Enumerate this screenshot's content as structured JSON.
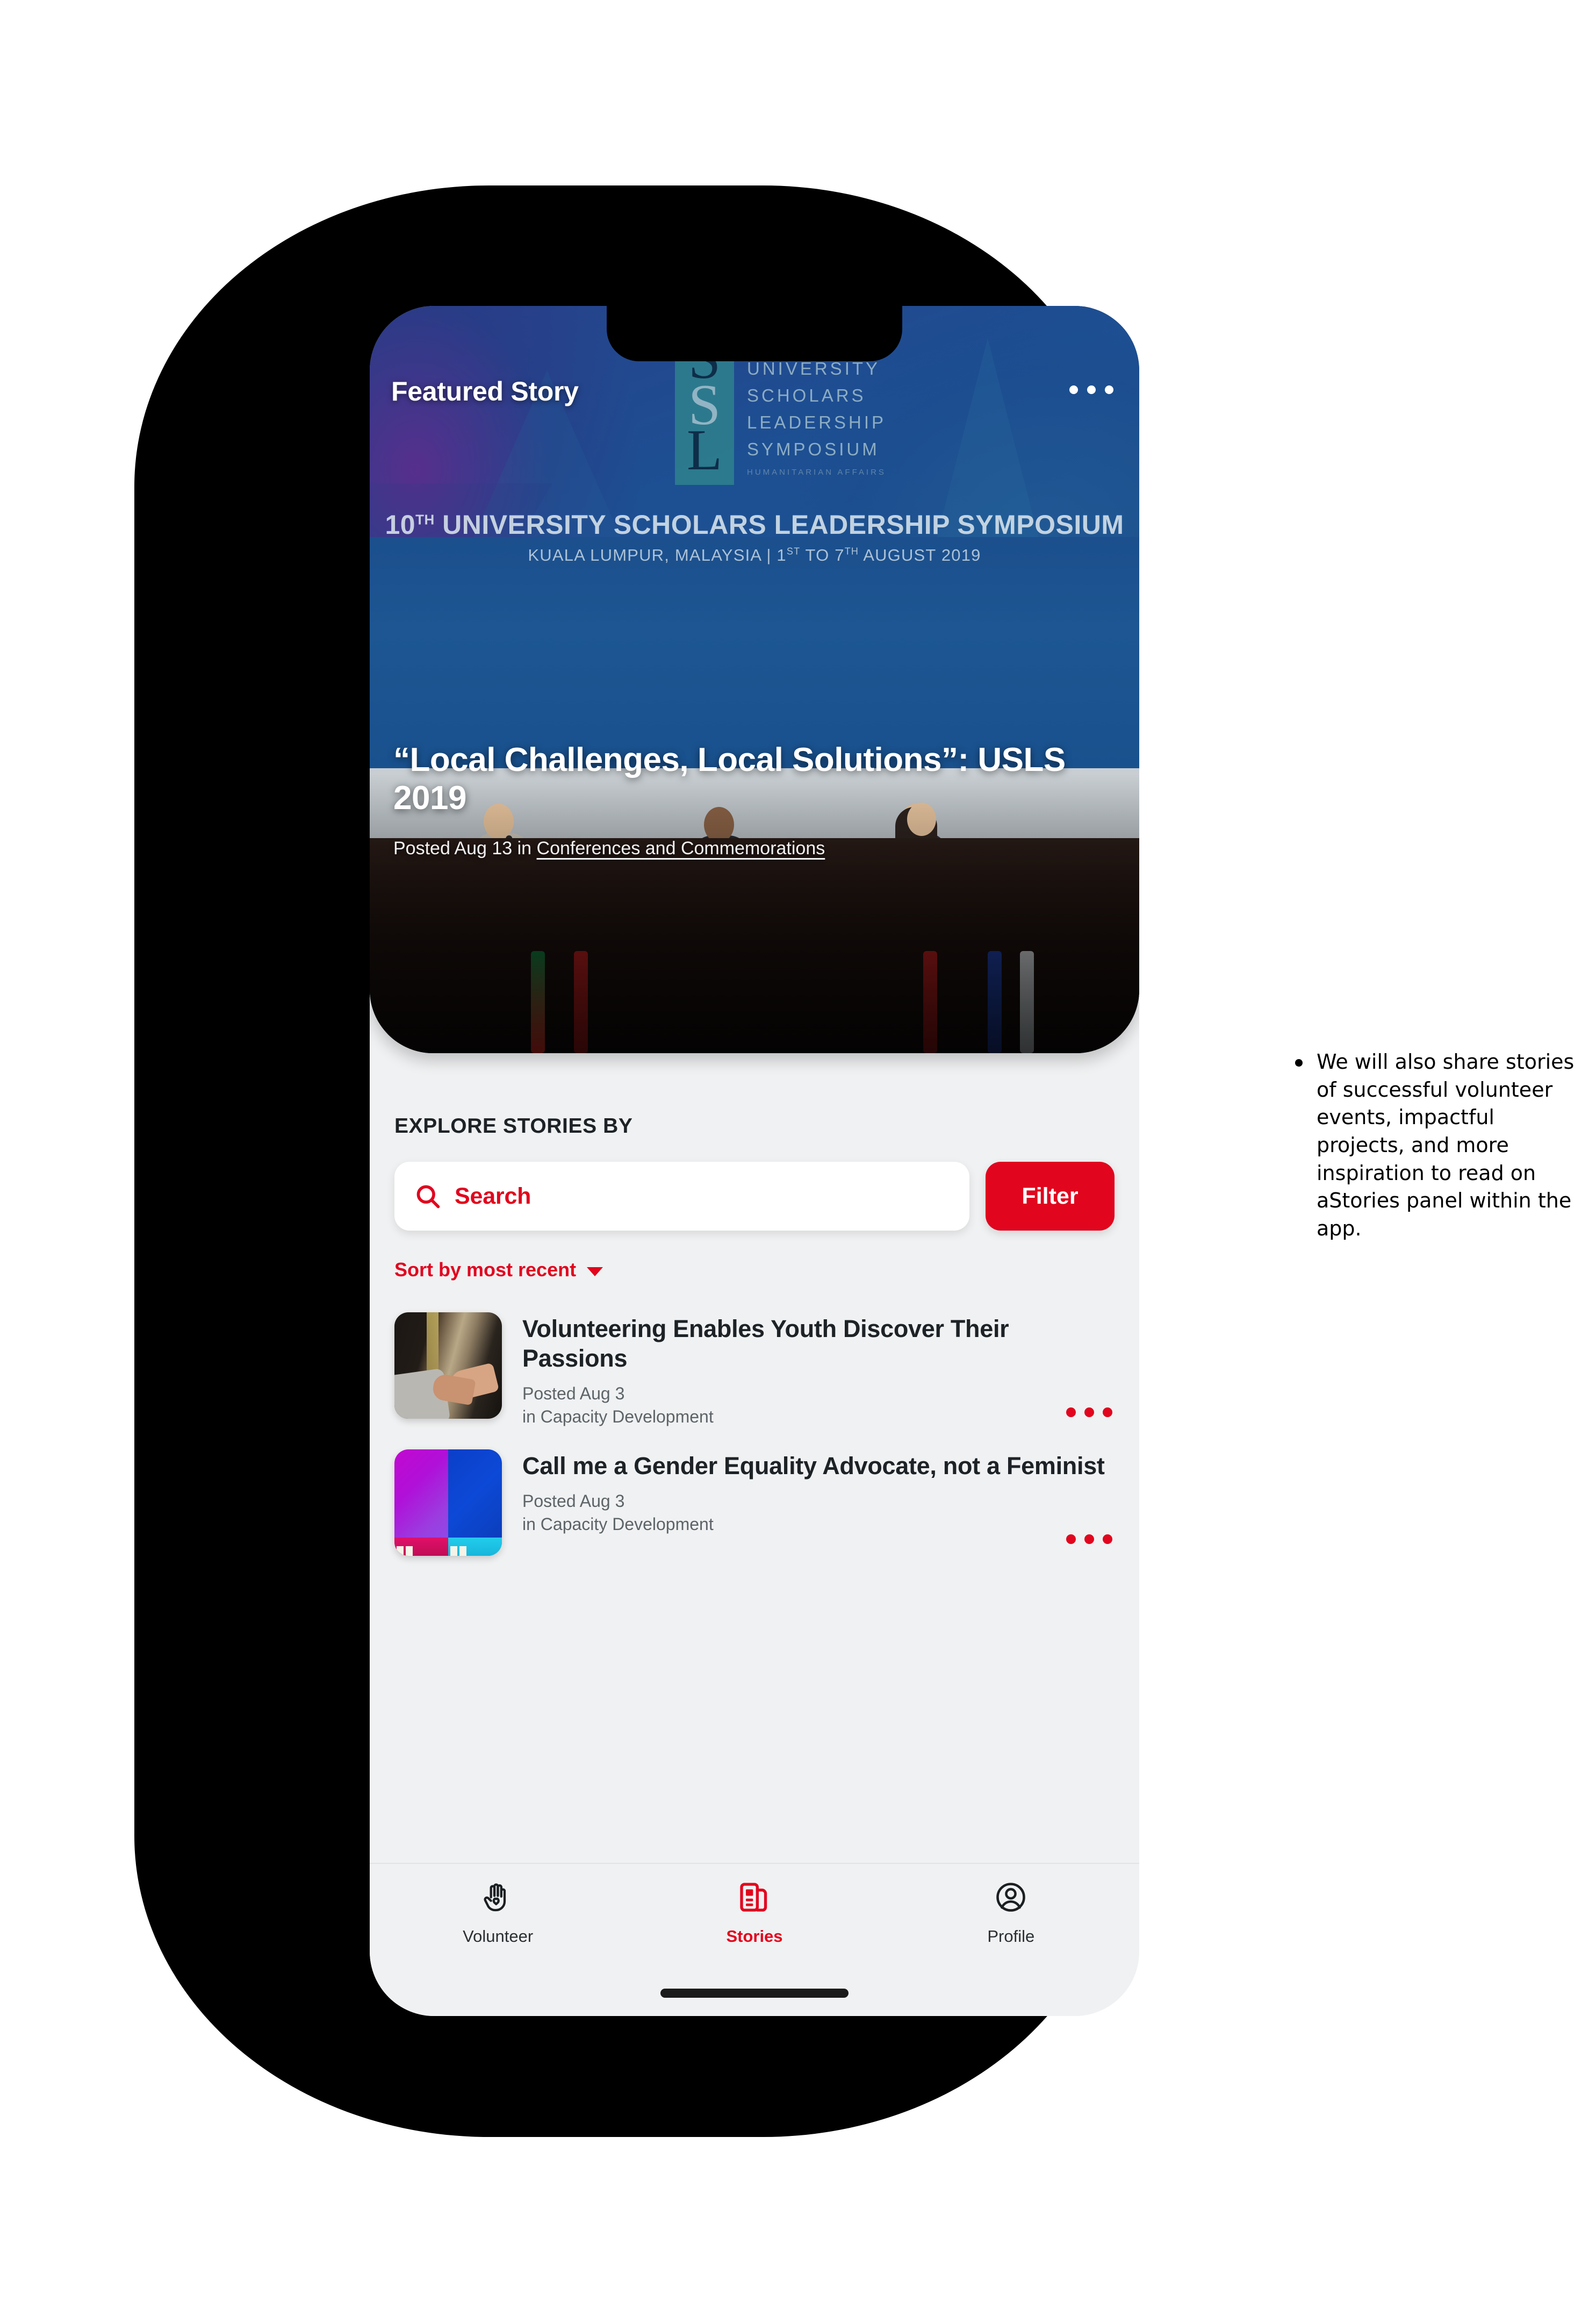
{
  "hero": {
    "featured_label": "Featured Story",
    "more_icon": "more-horizontal-icon",
    "logo": {
      "mark_letters": [
        "S",
        "S",
        "L"
      ],
      "words": [
        "UNIVERSITY",
        "SCHOLARS",
        "LEADERSHIP",
        "SYMPOSIUM"
      ],
      "subtitle": "HUMANITARIAN AFFAIRS"
    },
    "banner_line1_prefix": "10",
    "banner_line1_sup": "TH",
    "banner_line1_rest": " UNIVERSITY SCHOLARS LEADERSHIP SYMPOSIUM",
    "banner_line2_a": "KUALA LUMPUR, MALAYSIA  |  1",
    "banner_line2_sup1": "ST",
    "banner_line2_b": " TO 7",
    "banner_line2_sup2": "TH",
    "banner_line2_c": " AUGUST 2019",
    "title": "“Local Challenges, Local Solutions”: USLS 2019",
    "meta_prefix": "Posted Aug 13 in ",
    "meta_link": "Conferences and Commemorations"
  },
  "explore": {
    "heading": "EXPLORE STORIES BY",
    "search_placeholder": "Search",
    "search_value": "",
    "search_icon": "search-icon",
    "filter_label": "Filter",
    "sort_label": "Sort by most recent",
    "sort_chevron": "chevron-down-icon"
  },
  "stories": [
    {
      "title": "Volunteering Enables Youth Discover Their Passions",
      "posted": "Posted Aug 3",
      "category": "in Capacity Development",
      "thumbnail": "handshake-photo",
      "more_icon": "more-horizontal-icon"
    },
    {
      "title": "Call me a Gender Equality Advocate, not a Feminist",
      "posted": "Posted Aug 3",
      "category": "in Capacity Development",
      "thumbnail": "gender-figures-photo",
      "more_icon": "more-horizontal-icon"
    }
  ],
  "bottom_nav": {
    "items": [
      {
        "label": "Volunteer",
        "icon": "helping-hand-icon",
        "active": false
      },
      {
        "label": "Stories",
        "icon": "news-book-icon",
        "active": true
      },
      {
        "label": "Profile",
        "icon": "user-circle-icon",
        "active": false
      }
    ]
  },
  "annotation": {
    "text": "We will also share stories of successful volunteer events, impactful projects, and more inspiration to read on aStories panel within the app."
  },
  "colors": {
    "accent_red": "#e1051e",
    "screen_bg": "#f0f1f2",
    "hero_blue": "#1d5390",
    "text_dark": "#1d2226",
    "text_muted": "#5d6468"
  }
}
